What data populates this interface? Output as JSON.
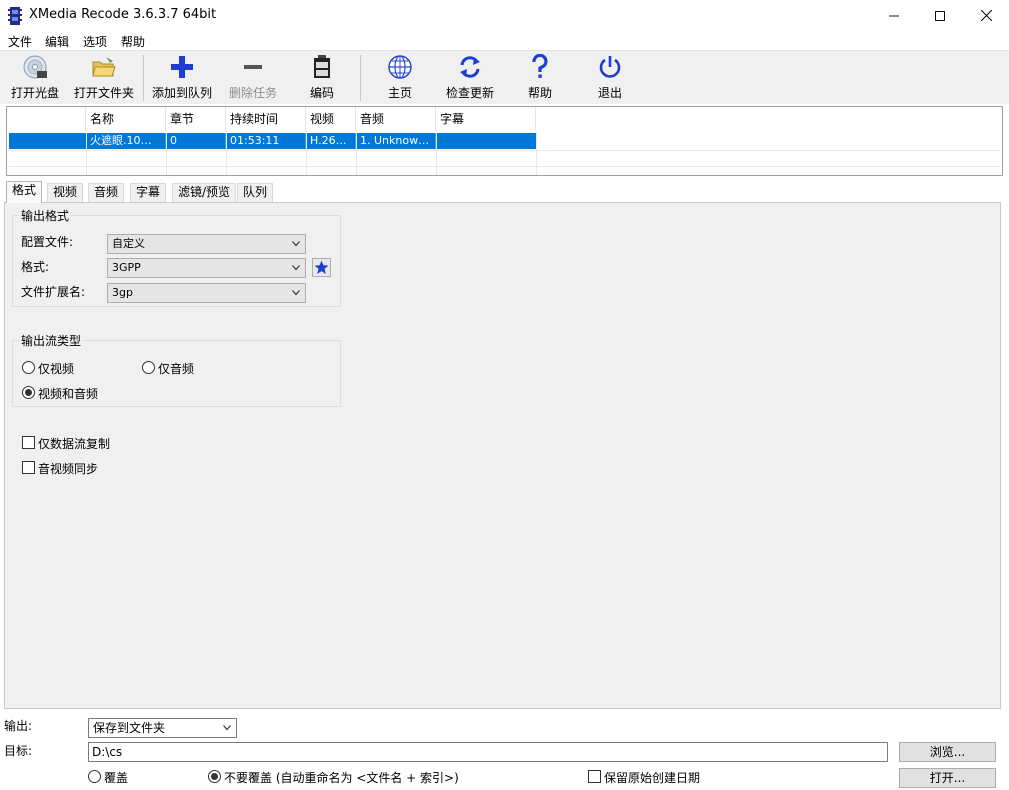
{
  "window": {
    "title": "XMedia Recode 3.6.3.7 64bit",
    "minimize": "—",
    "maximize": "☐",
    "close": "✕"
  },
  "menu": [
    "文件",
    "编辑",
    "选项",
    "帮助"
  ],
  "toolbar": {
    "open_disc": "打开光盘",
    "open_folder": "打开文件夹",
    "add_queue": "添加到队列",
    "remove_job": "删除任务",
    "encode": "编码",
    "home": "主页",
    "check_update": "检查更新",
    "help": "帮助",
    "exit": "退出"
  },
  "file_list": {
    "columns": [
      "名称",
      "章节",
      "持续时间",
      "视频",
      "音频",
      "字幕"
    ],
    "rows": [
      {
        "name": "火遮眼.10…",
        "chapter": "0",
        "duration": "01:53:11",
        "video": "H.26…",
        "audio": "1. Unknow…",
        "subtitle": ""
      }
    ]
  },
  "tabs": [
    "格式",
    "视频",
    "音频",
    "字幕",
    "滤镜/预览",
    "队列"
  ],
  "format": {
    "output_format_title": "输出格式",
    "profile_label": "配置文件:",
    "profile_value": "自定义",
    "format_label": "格式:",
    "format_value": "3GPP",
    "extension_label": "文件扩展名:",
    "extension_value": "3gp",
    "stream_type_title": "输出流类型",
    "video_only": "仅视频",
    "audio_only": "仅音频",
    "video_audio": "视频和音频",
    "selected_stream": "video_audio",
    "stream_copy_only": "仅数据流复制",
    "av_sync": "音视频同步"
  },
  "bottom": {
    "output_label": "输出:",
    "output_value": "保存到文件夹",
    "target_label": "目标:",
    "target_value": "D:\\cs",
    "browse": "浏览...",
    "open": "打开...",
    "overwrite": "覆盖",
    "no_overwrite": "不要覆盖 (自动重命名为 <文件名 + 索引>)",
    "keep_date": "保留原始创建日期"
  },
  "colors": {
    "selection": "#0078d7",
    "icon_blue": "#1d3fd0",
    "panel": "#f0f0f0"
  }
}
